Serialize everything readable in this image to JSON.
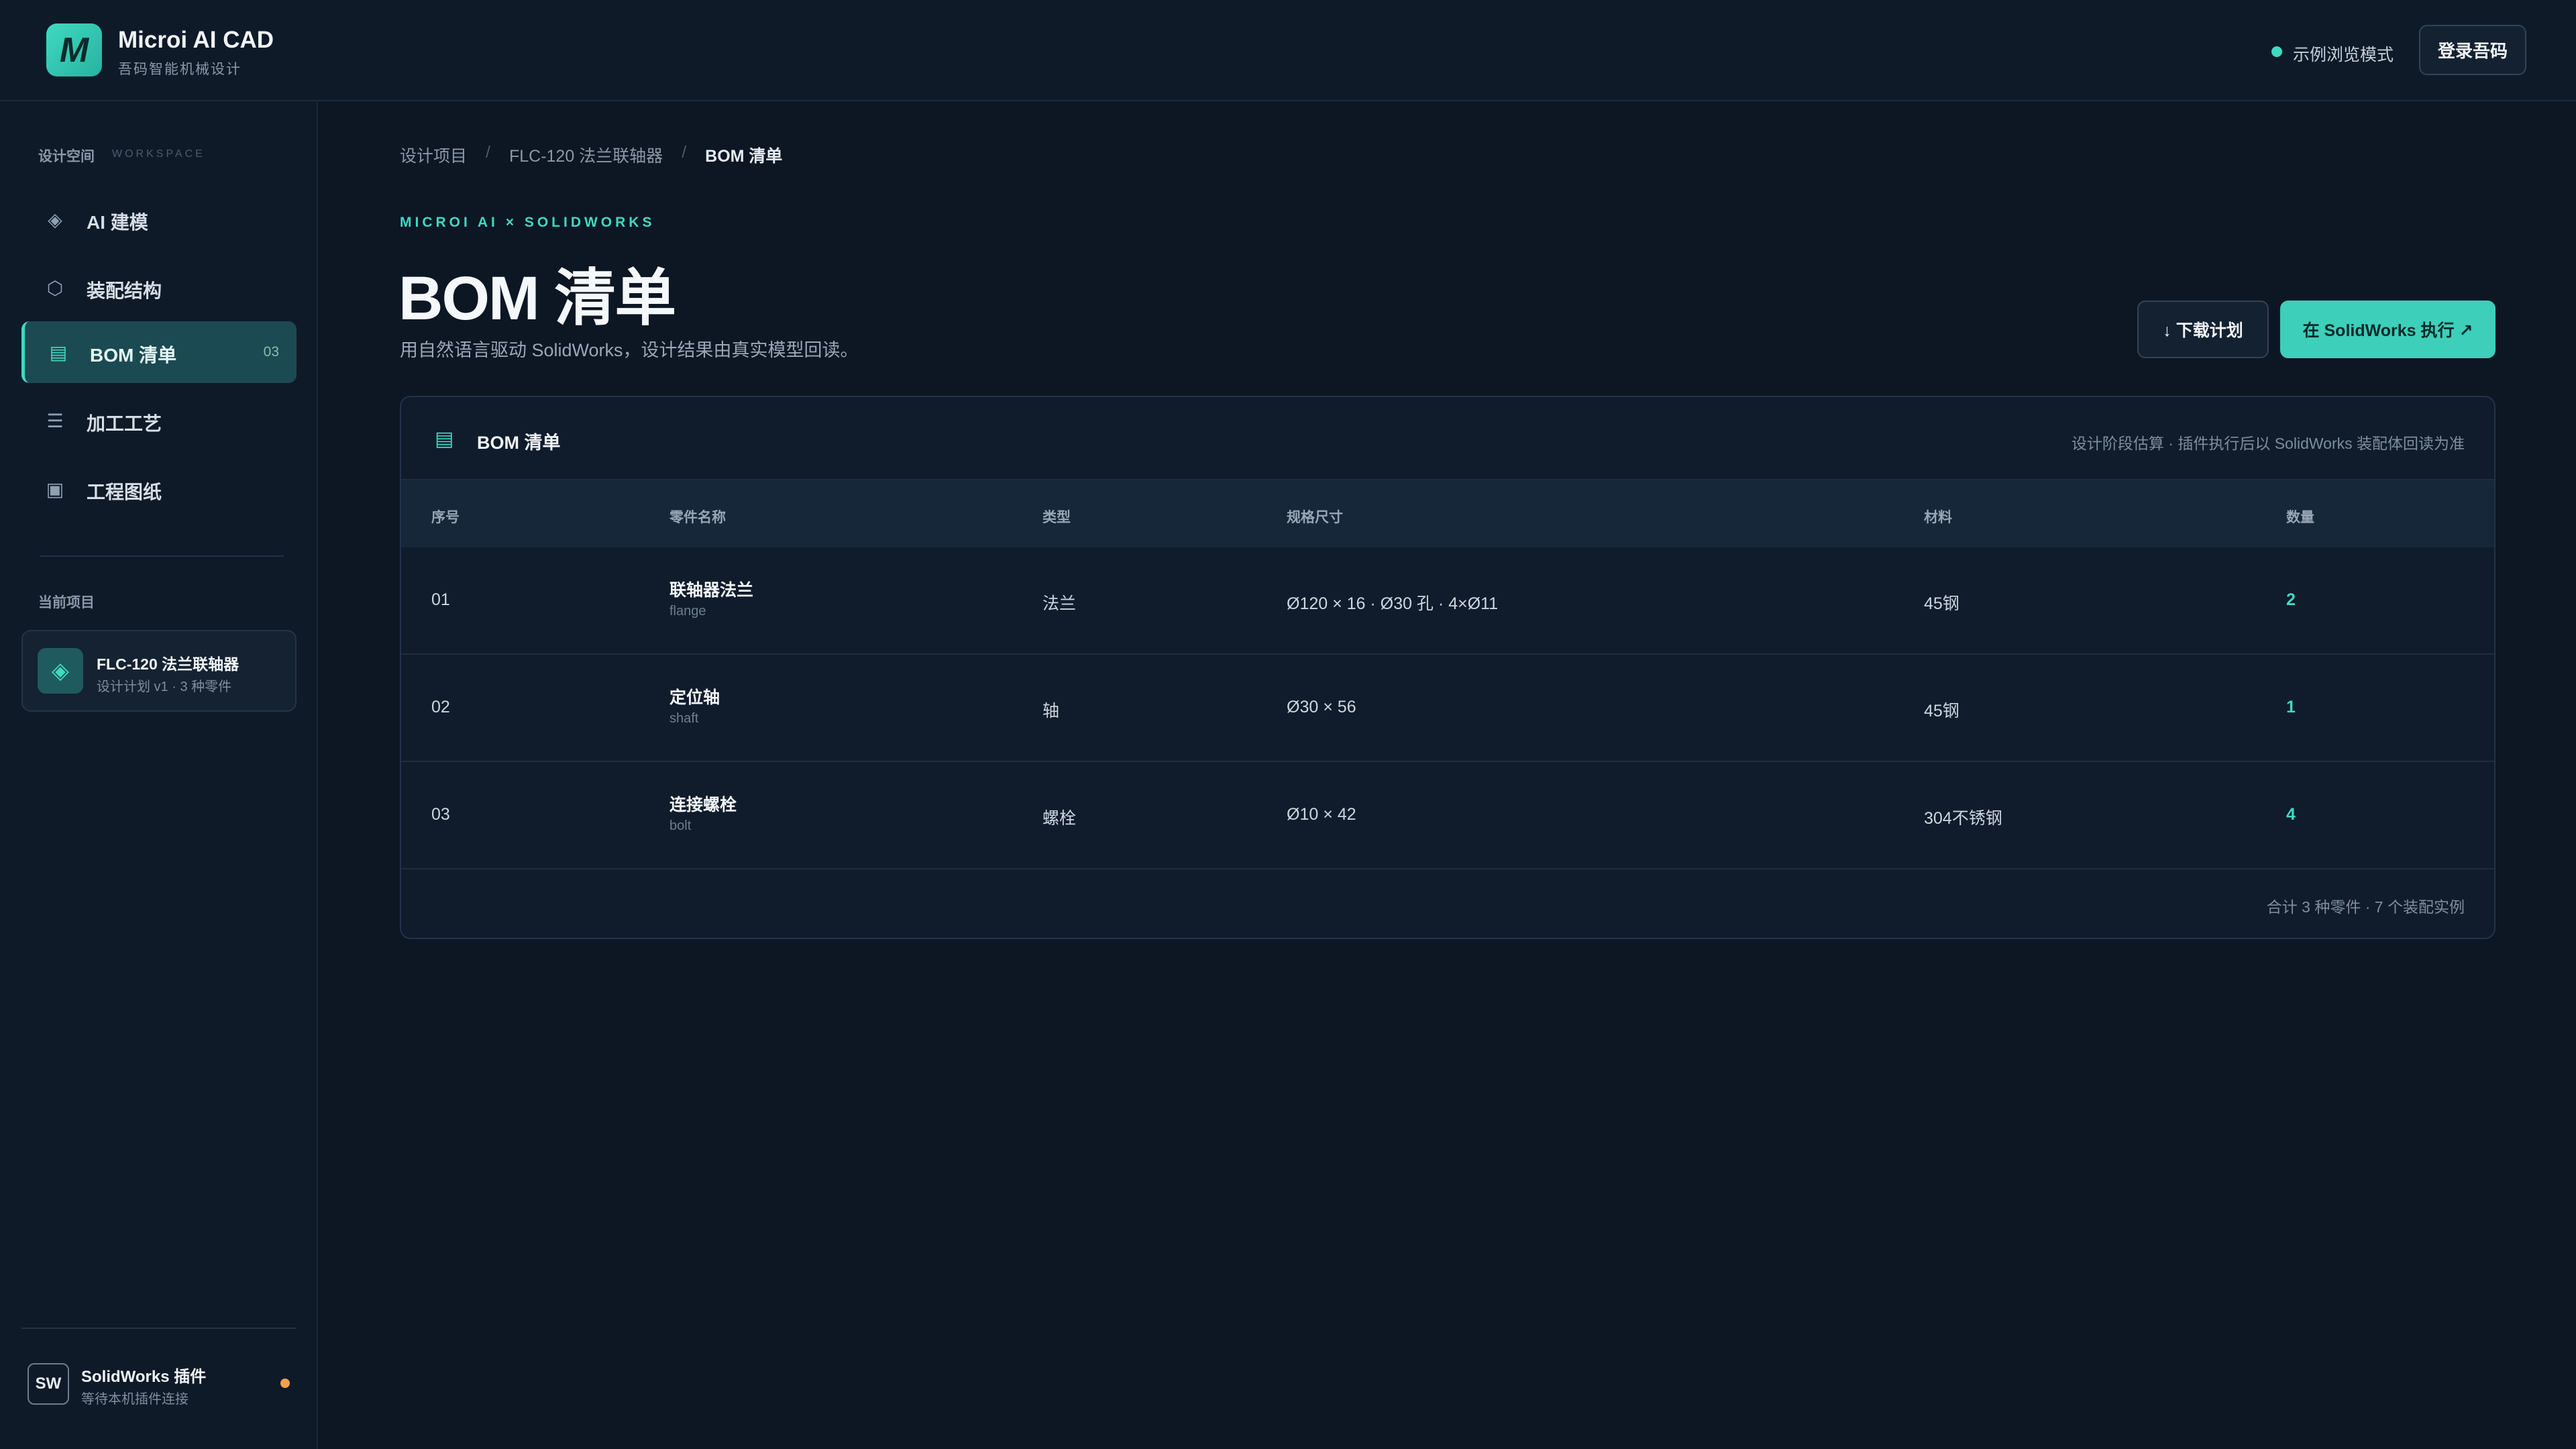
{
  "app": {
    "logo_letter": "M",
    "title": "Microi AI CAD",
    "subtitle": "吾码智能机械设计"
  },
  "header": {
    "mode_text": "示例浏览模式",
    "login_label": "登录吾码"
  },
  "sidebar": {
    "workspace_label": "设计空间",
    "workspace_sub": "WORKSPACE",
    "items": [
      {
        "icon": "diamond-icon",
        "glyph": "◈",
        "label": "AI 建模"
      },
      {
        "icon": "hexagon-icon",
        "glyph": "⬡",
        "label": "装配结构"
      },
      {
        "icon": "list-icon",
        "glyph": "▤",
        "label": "BOM 清单",
        "count": "03",
        "active": true
      },
      {
        "icon": "lines-icon",
        "glyph": "☰",
        "label": "加工工艺"
      },
      {
        "icon": "drawing-icon",
        "glyph": "▣",
        "label": "工程图纸"
      }
    ],
    "current_project_label": "当前项目",
    "project": {
      "icon": "diamond-icon",
      "glyph": "◈",
      "name": "FLC-120 法兰联轴器",
      "meta": "设计计划 v1 · 3 种零件"
    },
    "plugin": {
      "badge": "SW",
      "title": "SolidWorks 插件",
      "status": "等待本机插件连接",
      "status_color": "#f0a24a"
    }
  },
  "breadcrumb": {
    "level1": "设计项目",
    "level2": "FLC-120 法兰联轴器",
    "current": "BOM 清单",
    "separator": "/"
  },
  "page": {
    "eyebrow": "MICROI AI × SOLIDWORKS",
    "title": "BOM 清单",
    "description": "用自然语言驱动 SolidWorks，设计结果由真实模型回读。",
    "download_label": "↓ 下载计划",
    "execute_label": "在 SolidWorks 执行 ↗"
  },
  "bom": {
    "title": "BOM 清单",
    "note": "设计阶段估算 · 插件执行后以 SolidWorks 装配体回读为准",
    "columns": {
      "index": "序号",
      "name": "零件名称",
      "type": "类型",
      "spec": "规格尺寸",
      "material": "材料",
      "qty": "数量"
    },
    "rows": [
      {
        "index": "01",
        "name": "联轴器法兰",
        "name_en": "flange",
        "type": "法兰",
        "spec": "Ø120 × 16 · Ø30 孔 · 4×Ø11",
        "material": "45钢",
        "qty": "2"
      },
      {
        "index": "02",
        "name": "定位轴",
        "name_en": "shaft",
        "type": "轴",
        "spec": "Ø30 × 56",
        "material": "45钢",
        "qty": "1"
      },
      {
        "index": "03",
        "name": "连接螺栓",
        "name_en": "bolt",
        "type": "螺栓",
        "spec": "Ø10 × 42",
        "material": "304不锈钢",
        "qty": "4"
      }
    ],
    "footer": "合计 3 种零件 · 7 个装配实例"
  },
  "colors": {
    "accent": "#3fd9c2",
    "background": "#0d1623",
    "warning": "#f0a24a"
  }
}
